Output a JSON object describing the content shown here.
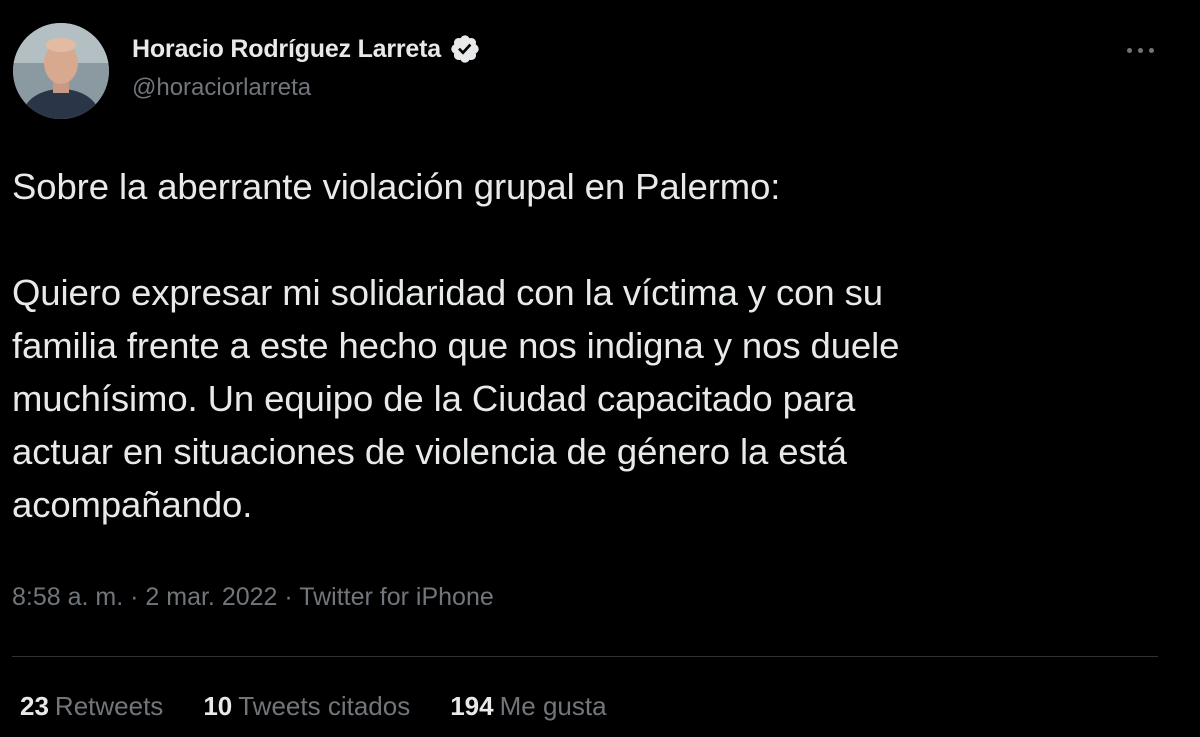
{
  "author": {
    "name": "Horacio Rodríguez Larreta",
    "handle": "@horaciorlarreta",
    "verified_icon": "verified-badge-icon"
  },
  "tweet": {
    "lines": [
      "Sobre la aberrante violación grupal en Palermo:",
      "",
      "Quiero expresar mi solidaridad con la víctima y con su",
      "familia frente a este hecho que nos indigna y nos duele",
      "muchísimo. Un equipo de la Ciudad capacitado para",
      "actuar en situaciones de violencia de género la está",
      "acompañando."
    ]
  },
  "meta": {
    "time": "8:58 a. m.",
    "separator": "·",
    "date": "2 mar. 2022",
    "source": "Twitter for iPhone"
  },
  "stats": {
    "retweets": {
      "count": "23",
      "label": "Retweets"
    },
    "quotes": {
      "count": "10",
      "label": "Tweets citados"
    },
    "likes": {
      "count": "194",
      "label": "Me gusta"
    }
  },
  "colors": {
    "background": "#000000",
    "text": "#e7e9ea",
    "secondary": "#71767b",
    "divider": "#2f3336"
  }
}
